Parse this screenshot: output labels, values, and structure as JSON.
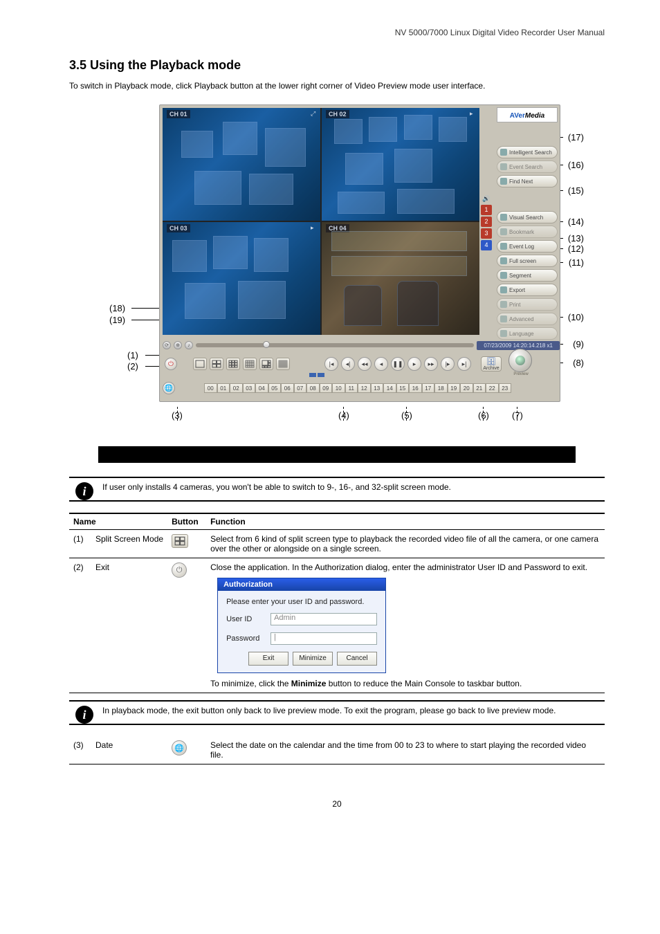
{
  "header_text": "NV 5000/7000 Linux Digital Video Recorder User Manual",
  "section_title": "3.5  Using the Playback mode",
  "intro_text": "To switch in Playback mode, click Playback button at the lower right corner of ",
  "intro_tail": " Video Preview mode user interface.",
  "callouts": {
    "r17": "(17)",
    "r16": "(16)",
    "r15": "(15)",
    "r14": "(14)",
    "r13": "(13)",
    "r12": "(12)",
    "r11": "(11)",
    "r10": "(10)",
    "r9": "(9)",
    "r8": "(8)",
    "l18": "(18)",
    "l19": "(19)",
    "l1": "(1)",
    "l2": "(2)",
    "b3": "(3)",
    "b4": "(4)",
    "b5": "(5)",
    "b6": "(6)",
    "b7": "(7)"
  },
  "channels": {
    "0": "CH 01",
    "1": "CH 02",
    "2": "CH 03",
    "3": "CH 04"
  },
  "logo_a": "AVer",
  "logo_b": "Media",
  "sidebar": {
    "intelligent": "Intelligent Search",
    "event": "Event Search",
    "find": "Find Next",
    "visual": "Visual Search",
    "bookmark": "Bookmark",
    "eventlog": "Event Log",
    "full": "Full screen",
    "segment": "Segment",
    "export": "Export",
    "print": "Print",
    "advanced": "Advanced",
    "language": "Language"
  },
  "chan_nums": [
    "1",
    "2",
    "3",
    "4"
  ],
  "timestamp": "07/23/2009 14:20:14.218   x1",
  "archive_label": "Archive",
  "preview_label": "Preview",
  "hours": [
    "00",
    "01",
    "02",
    "03",
    "04",
    "05",
    "06",
    "07",
    "08",
    "09",
    "10",
    "11",
    "12",
    "13",
    "14",
    "15",
    "16",
    "17",
    "18",
    "19",
    "20",
    "21",
    "22",
    "23"
  ],
  "note1": "If user only installs 4 cameras, you won't be able to switch to 9-, 16-, and 32-split screen mode.",
  "table_headers": [
    "Name",
    "Button",
    "Function"
  ],
  "rows": {
    "split": {
      "num": "(1)",
      "name": "Split Screen Mode",
      "desc_a": "Select from 6 kind of split screen type to playback the recorded video file of all the camera, or one camera over the other or alongside on a single screen."
    },
    "exit": {
      "num": "(2)",
      "name": "Exit",
      "desc_a": "Close the application. In the Authorization dialog, enter the administrator User ID and Password to exit.",
      "desc_b": "To minimize, click the ",
      "desc_c": "Minimize",
      "desc_d": " button to reduce the Main Console to taskbar button."
    }
  },
  "auth": {
    "title": "Authorization",
    "prompt": "Please enter your user ID and password.",
    "user_lbl": "User ID",
    "user_val": "Admin",
    "pwd_lbl": "Password",
    "btn_exit": "Exit",
    "btn_min": "Minimize",
    "btn_cancel": "Cancel"
  },
  "note2": "In playback mode, the exit button only back to live preview mode. To exit the program, please go back to live preview mode.",
  "row3": {
    "num": "(3)",
    "name": "Date",
    "desc": "Select the date on the calendar and the time from 00 to 23 to where to start playing the recorded video file."
  },
  "page_num": "20"
}
